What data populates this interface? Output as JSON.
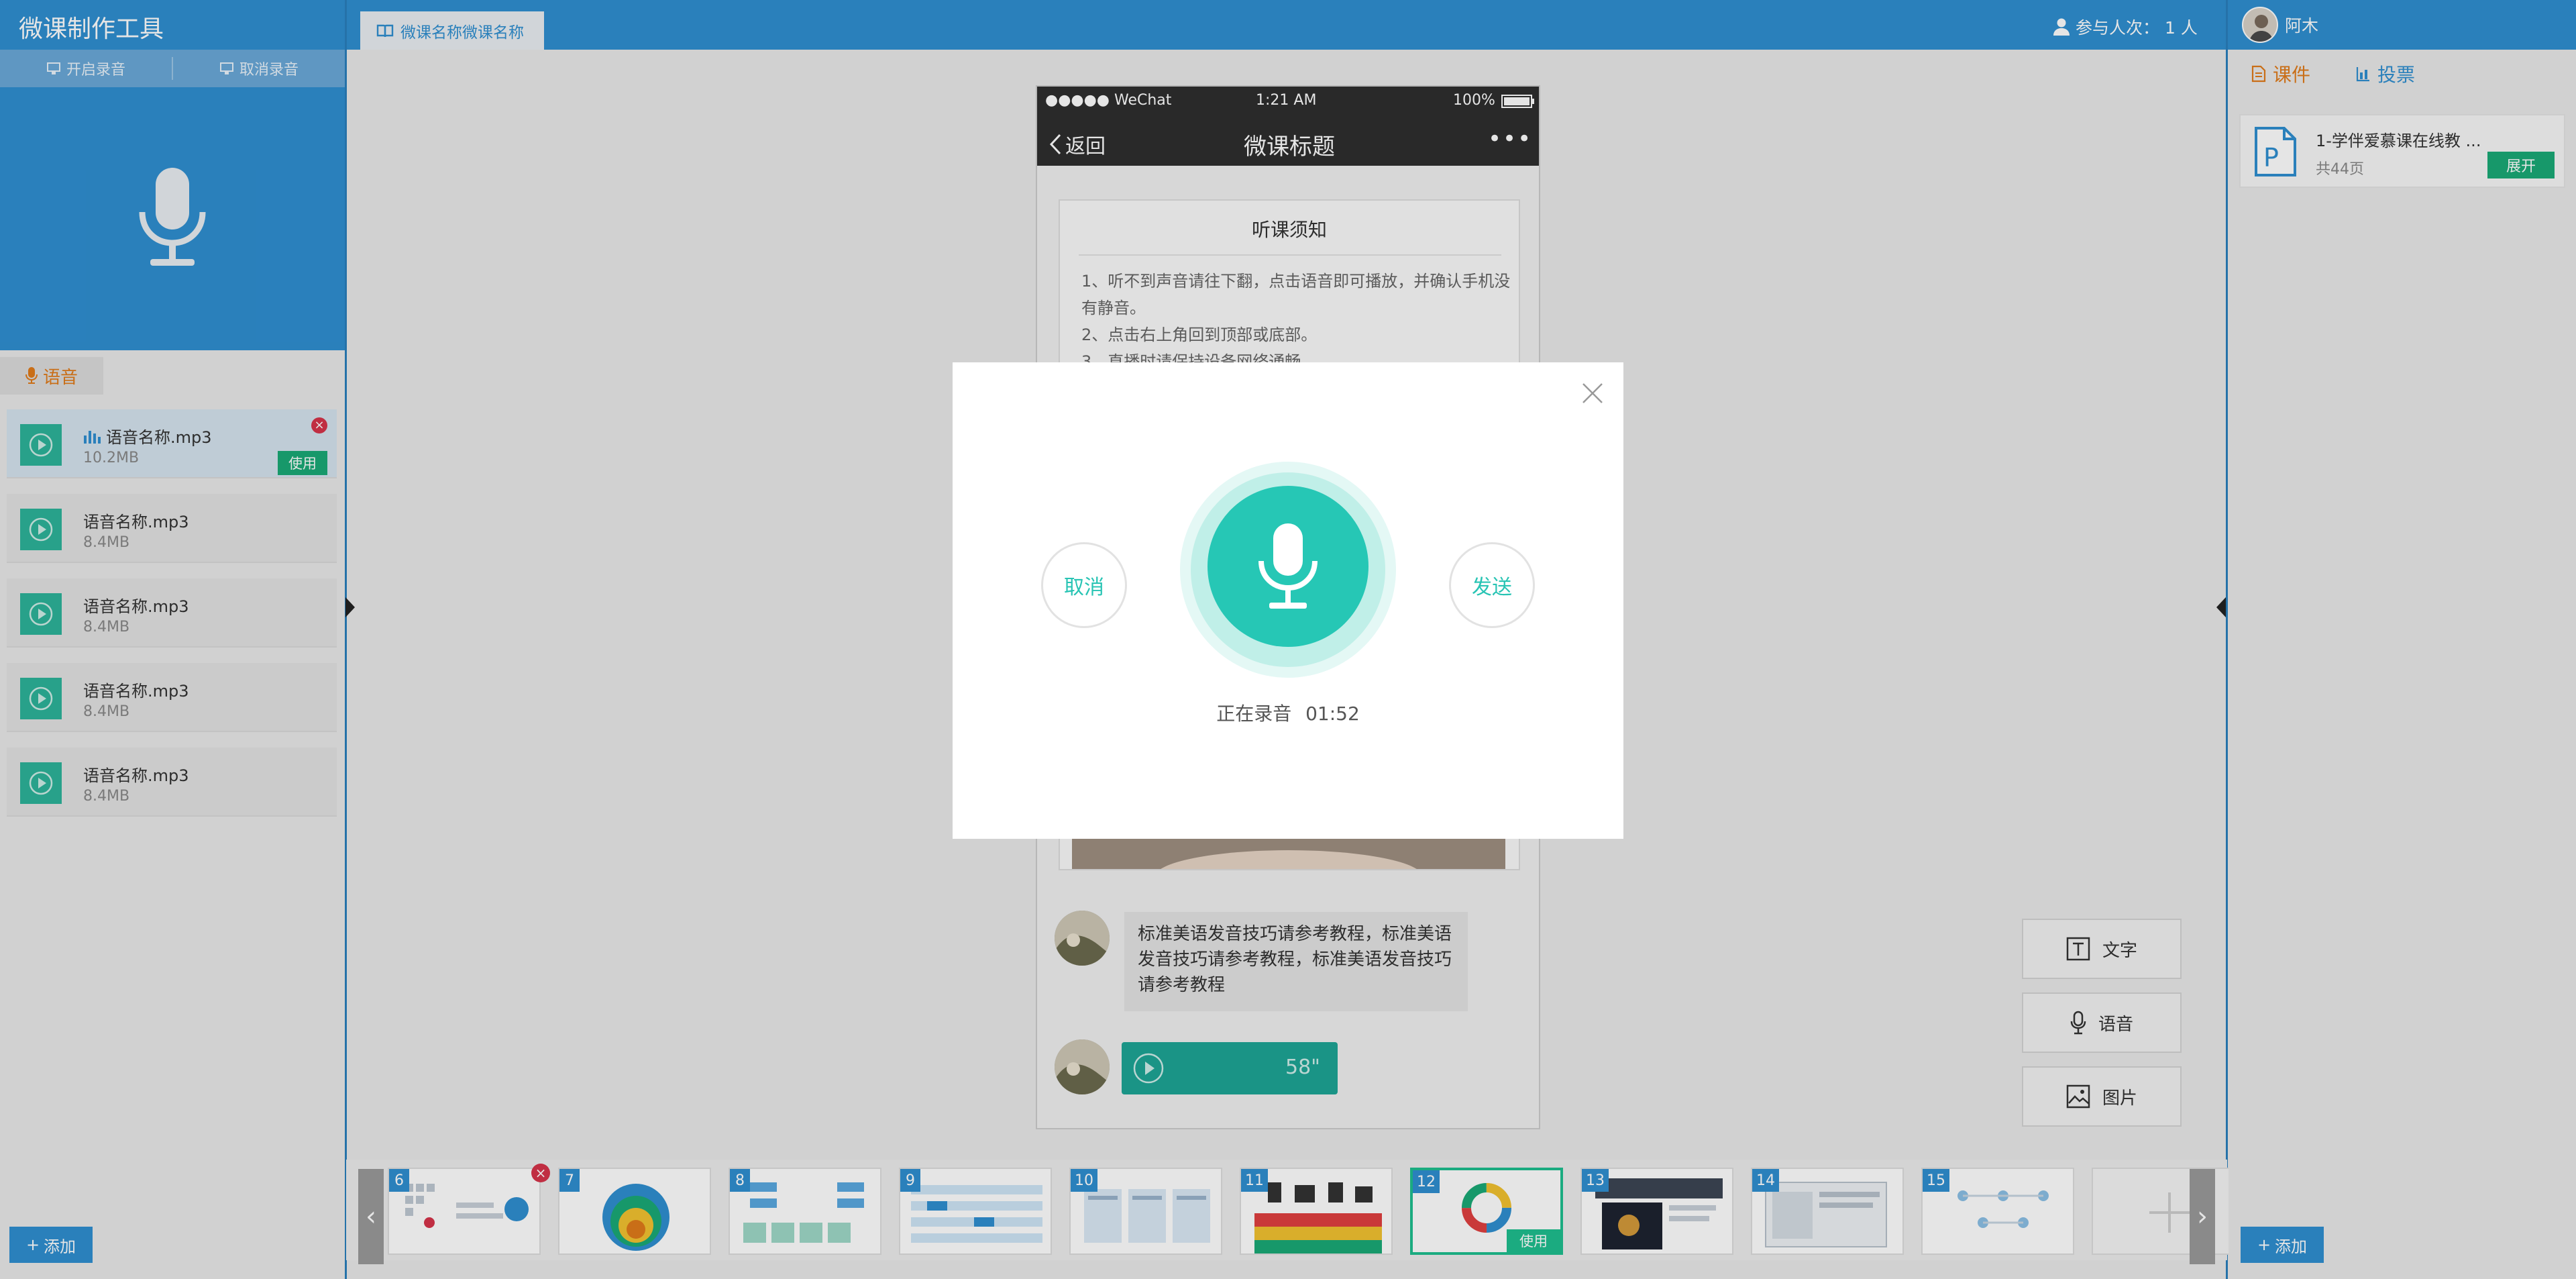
{
  "header": {
    "app_title": "微课制作工具",
    "course_tab": "微课名称微课名称",
    "participants_label": "参与人次：",
    "participants_count": "1 人",
    "user_name": "阿木"
  },
  "left": {
    "toolbar": {
      "start_record": "开启录音",
      "cancel_record": "取消录音"
    },
    "voice_tab": "语音",
    "audio_items": [
      {
        "name": "语音名称.mp3",
        "size": "10.2MB",
        "use_label": "使用"
      },
      {
        "name": "语音名称.mp3",
        "size": "8.4MB"
      },
      {
        "name": "语音名称.mp3",
        "size": "8.4MB"
      },
      {
        "name": "语音名称.mp3",
        "size": "8.4MB"
      },
      {
        "name": "语音名称.mp3",
        "size": "8.4MB"
      }
    ],
    "add_label": "添加"
  },
  "phone": {
    "carrier": "●●●●● WeChat",
    "time": "1:21 AM",
    "battery": "100%",
    "back_label": "返回",
    "title": "微课标题",
    "more": "•••",
    "notice_title": "听课须知",
    "notice_lines": [
      "1、听不到声音请往下翻，点击语音即可播放，并确认手机没有静音。",
      "2、点击右上角回到顶部或底部。",
      "3、直播时请保持设备网络通畅。"
    ],
    "message_text": "标准美语发音技巧请参考教程，标准美语发音技巧请参考教程，标准美语发音技巧请参考教程",
    "voice_duration": "58\""
  },
  "tools": {
    "text": "文字",
    "voice": "语音",
    "image": "图片"
  },
  "thumbnails": [
    {
      "num": "6"
    },
    {
      "num": "7"
    },
    {
      "num": "8"
    },
    {
      "num": "9"
    },
    {
      "num": "10"
    },
    {
      "num": "11"
    },
    {
      "num": "12",
      "use_label": "使用"
    },
    {
      "num": "13"
    },
    {
      "num": "14"
    },
    {
      "num": "15"
    }
  ],
  "right": {
    "tab_courseware": "课件",
    "tab_vote": "投票",
    "doc_title": "1-学伴爱慕课在线教 ...",
    "doc_pages": "共44页",
    "expand_label": "展开",
    "add_label": "添加"
  },
  "modal": {
    "cancel": "取消",
    "send": "发送",
    "status": "正在录音",
    "elapsed": "01:52"
  },
  "colors": {
    "brand_blue": "#2f8fd1",
    "teal": "#26c7b5",
    "green": "#1aaa77",
    "orange": "#e07b1a",
    "danger": "#d6344a"
  }
}
